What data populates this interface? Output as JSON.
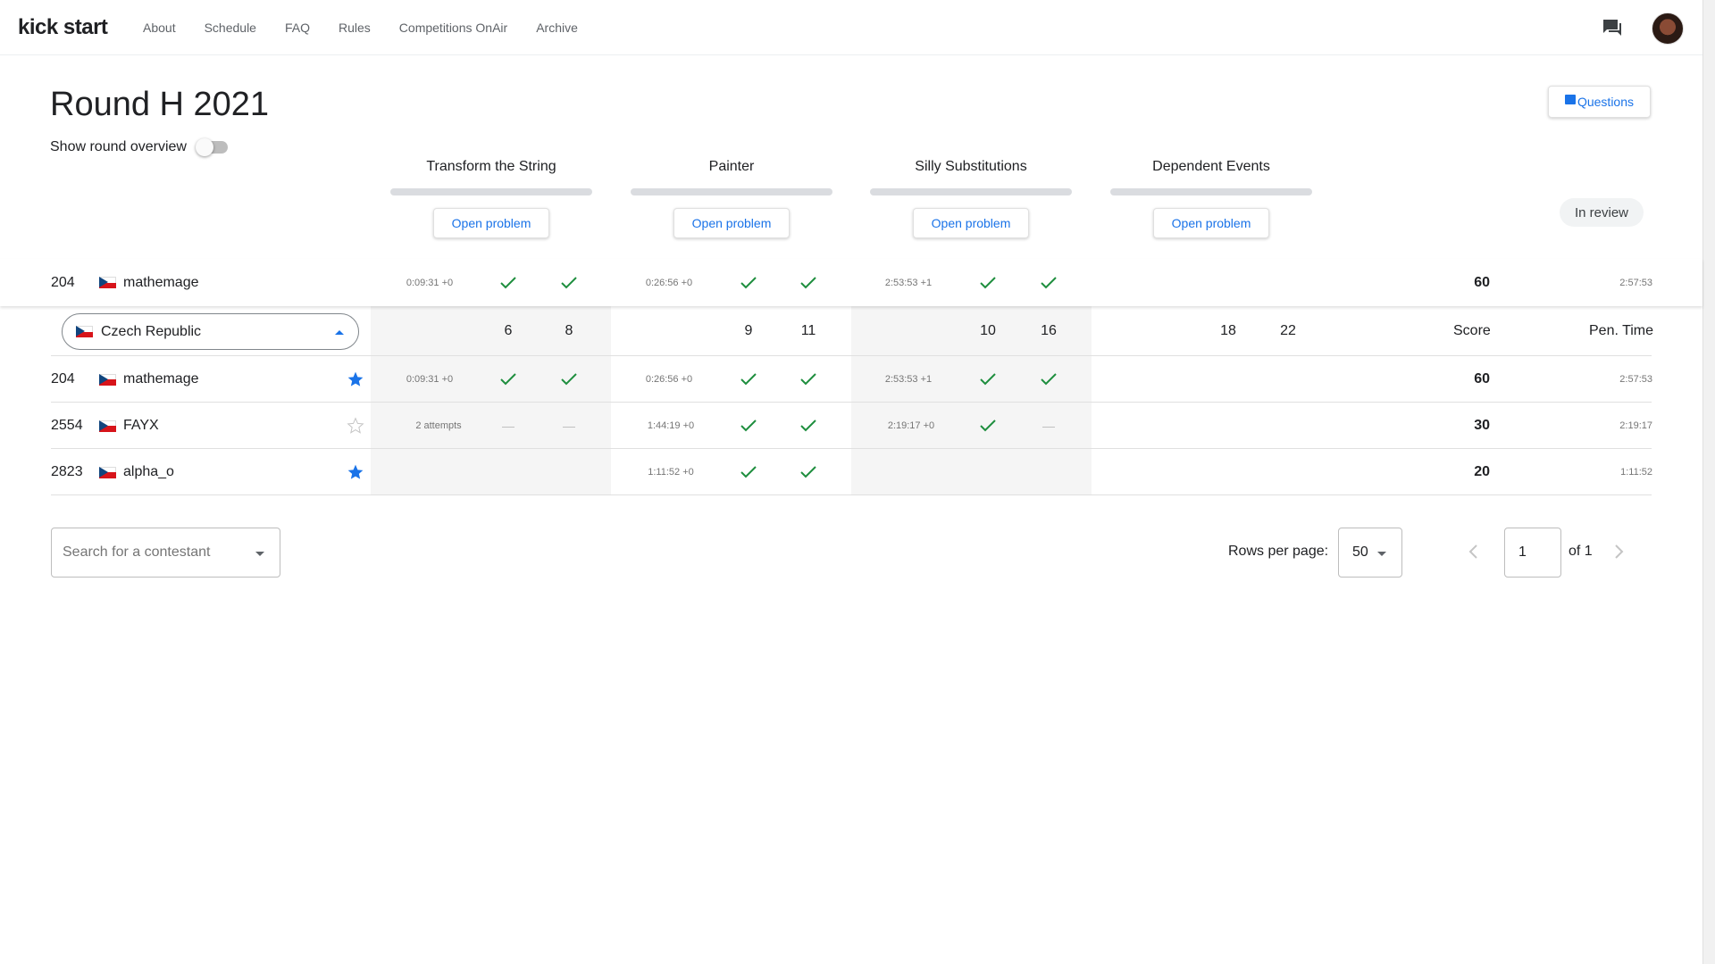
{
  "brand": {
    "logo": "kick start"
  },
  "nav": [
    "About",
    "Schedule",
    "FAQ",
    "Rules",
    "Competitions OnAir",
    "Archive"
  ],
  "round": {
    "title": "Round H 2021",
    "overview_label": "Show round overview",
    "questions_label": "Questions",
    "status": "In review"
  },
  "problems": [
    {
      "name": "Transform the String",
      "action": "Open problem",
      "visible_pts": 6,
      "hidden_pts": 8
    },
    {
      "name": "Painter",
      "action": "Open problem",
      "visible_pts": 9,
      "hidden_pts": 11
    },
    {
      "name": "Silly Substitutions",
      "action": "Open problem",
      "visible_pts": 10,
      "hidden_pts": 16
    },
    {
      "name": "Dependent Events",
      "action": "Open problem",
      "visible_pts": 18,
      "hidden_pts": 22
    }
  ],
  "my_row": {
    "rank": "204",
    "name": "mathemage",
    "times": [
      "0:09:31 +0",
      "0:26:56 +0",
      "2:53:53 +1"
    ],
    "score": "60",
    "pen_time": "2:57:53"
  },
  "filter": {
    "country": "Czech Republic",
    "score_header": "Score",
    "pen_header": "Pen. Time"
  },
  "rows": [
    {
      "rank": "204",
      "name": "mathemage",
      "starred": true,
      "p1": "0:09:31 +0",
      "p2": "0:26:56 +0",
      "p3": "2:53:53 +1",
      "score": "60",
      "pen": "2:57:53"
    },
    {
      "rank": "2554",
      "name": "FAYX",
      "starred": false,
      "p1": "2 attempts",
      "p2": "1:44:19 +0",
      "p3": "2:19:17 +0",
      "score": "30",
      "pen": "2:19:17"
    },
    {
      "rank": "2823",
      "name": "alpha_o",
      "starred": true,
      "p1": "",
      "p2": "1:11:52 +0",
      "p3": "",
      "score": "20",
      "pen": "1:11:52"
    }
  ],
  "search": {
    "placeholder": "Search for a contestant"
  },
  "pagination": {
    "rows_label": "Rows per page:",
    "rows_value": "50",
    "page": "1",
    "of_label": "of 1"
  },
  "colors": {
    "accent": "#1a73e8",
    "check": "#1e8e3e",
    "star_active": "#1a73e8"
  }
}
